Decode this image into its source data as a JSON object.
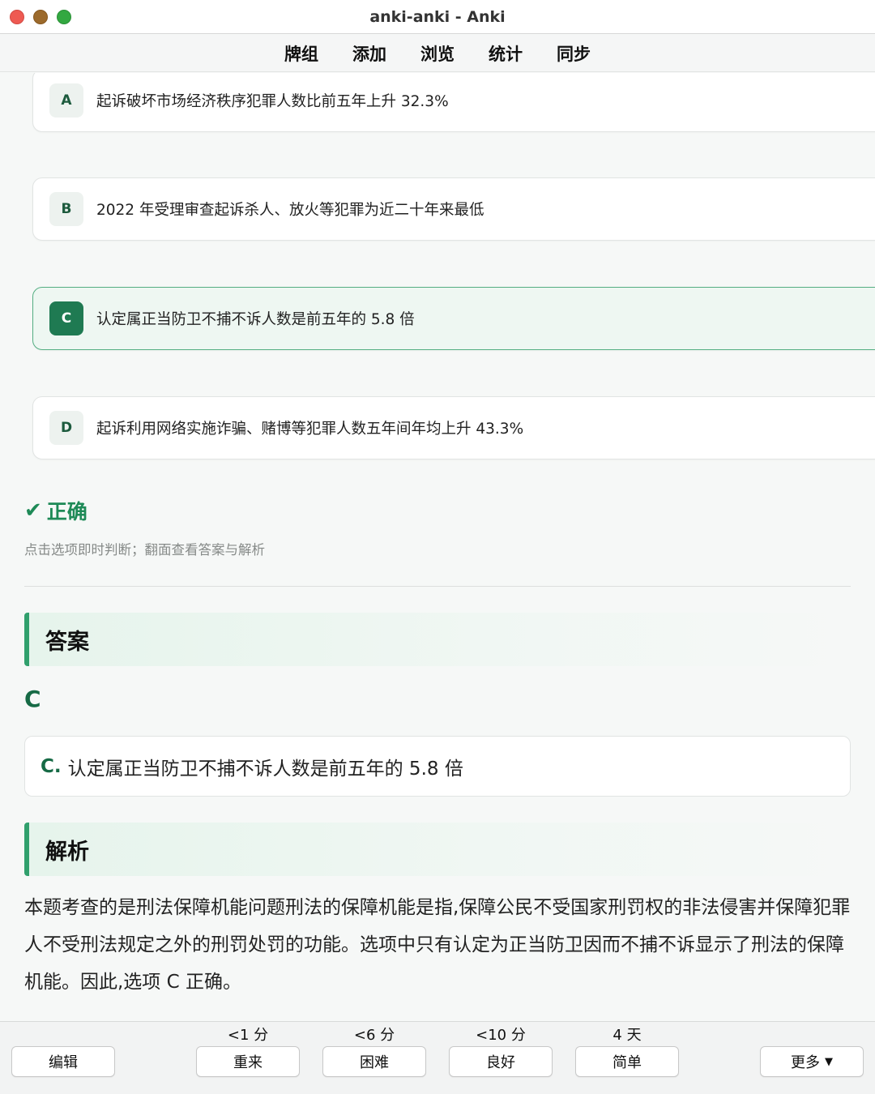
{
  "window": {
    "title": "anki-anki - Anki"
  },
  "toolbar": {
    "items": [
      "牌组",
      "添加",
      "浏览",
      "统计",
      "同步"
    ]
  },
  "options": [
    {
      "letter": "A",
      "text": "起诉破坏市场经济秩序犯罪人数比前五年上升 32.3%",
      "selected": false
    },
    {
      "letter": "B",
      "text": "2022 年受理审查起诉杀人、放火等犯罪为近二十年来最低",
      "selected": false
    },
    {
      "letter": "C",
      "text": "认定属正当防卫不捕不诉人数是前五年的 5.8 倍",
      "selected": true
    },
    {
      "letter": "D",
      "text": "起诉利用网络实施诈骗、赌博等犯罪人数五年间年均上升 43.3%",
      "selected": false
    }
  ],
  "result": {
    "icon": "check-icon",
    "text": "正确",
    "color": "#1e8a57"
  },
  "hint": "点击选项即时判断；翻面查看答案与解析",
  "answer": {
    "heading": "答案",
    "letter": "C",
    "prefix": "C.",
    "text": "认定属正当防卫不捕不诉人数是前五年的 5.8 倍"
  },
  "analysis": {
    "heading": "解析",
    "text": "本题考查的是刑法保障机能问题刑法的保障机能是指,保障公民不受国家刑罚权的非法侵害并保障犯罪人不受刑法规定之外的刑罚处罚的功能。选项中只有认定为正当防卫因而不捕不诉显示了刑法的保障机能。因此,选项 C 正确。"
  },
  "bottom": {
    "edit_label": "编辑",
    "more_label": "更多",
    "answers": [
      {
        "interval": "<1 分",
        "label": "重来"
      },
      {
        "interval": "<6 分",
        "label": "困难"
      },
      {
        "interval": "<10 分",
        "label": "良好"
      },
      {
        "interval": "4 天",
        "label": "简单"
      }
    ]
  },
  "colors": {
    "accent": "#1f7a52",
    "selected_border": "#54ae82",
    "section_bar": "#31a06d"
  }
}
